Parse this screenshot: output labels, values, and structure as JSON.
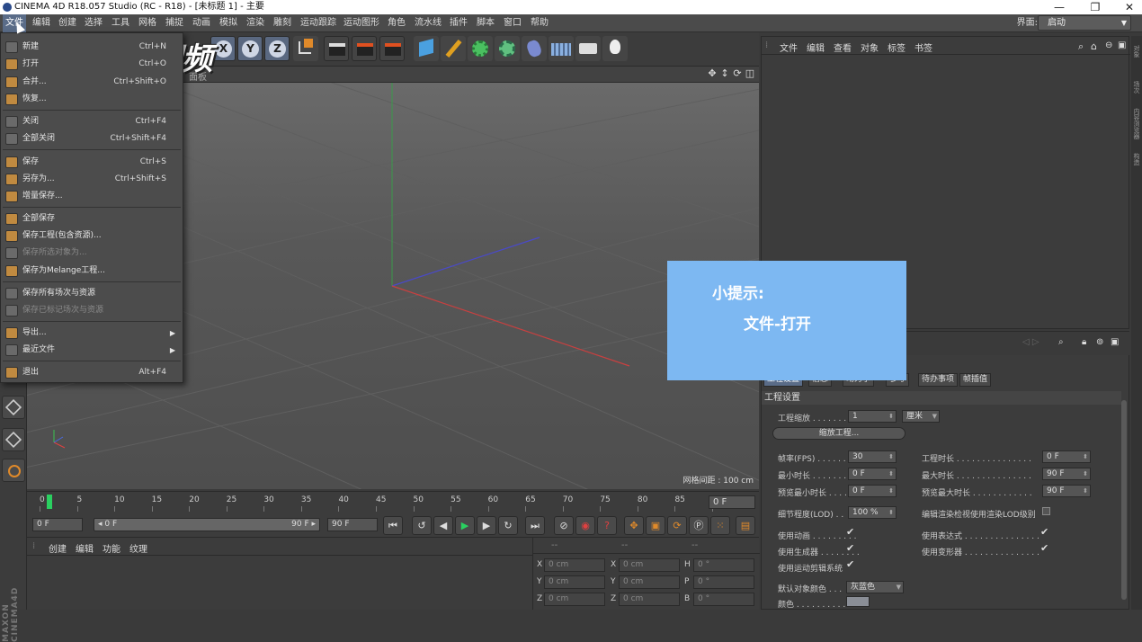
{
  "window": {
    "title": "CINEMA 4D R18.057 Studio (RC - R18) - [未标题 1] - 主要",
    "minimize": "—",
    "restore": "❐",
    "close": "✕"
  },
  "menubar": {
    "items": [
      "文件",
      "编辑",
      "创建",
      "选择",
      "工具",
      "网格",
      "捕捉",
      "动画",
      "模拟",
      "渲染",
      "雕刻",
      "运动跟踪",
      "运动图形",
      "角色",
      "流水线",
      "插件",
      "脚本",
      "窗口",
      "帮助"
    ],
    "layout_label": "界面:",
    "layout_value": "启动"
  },
  "file_menu": {
    "items": [
      {
        "label": "新建",
        "shortcut": "Ctrl+N",
        "enabled": true
      },
      {
        "label": "打开",
        "shortcut": "Ctrl+O",
        "enabled": true
      },
      {
        "label": "合并...",
        "shortcut": "Ctrl+Shift+O",
        "enabled": true
      },
      {
        "label": "恢复...",
        "shortcut": "",
        "enabled": true
      },
      {
        "label": "关闭",
        "shortcut": "Ctrl+F4",
        "enabled": true
      },
      {
        "label": "全部关闭",
        "shortcut": "Ctrl+Shift+F4",
        "enabled": true
      },
      {
        "label": "保存",
        "shortcut": "Ctrl+S",
        "enabled": true
      },
      {
        "label": "另存为...",
        "shortcut": "Ctrl+Shift+S",
        "enabled": true
      },
      {
        "label": "增量保存...",
        "shortcut": "",
        "enabled": true
      },
      {
        "label": "全部保存",
        "shortcut": "",
        "enabled": true
      },
      {
        "label": "保存工程(包含资源)...",
        "shortcut": "",
        "enabled": true
      },
      {
        "label": "保存所选对象为...",
        "shortcut": "",
        "enabled": false
      },
      {
        "label": "保存为Melange工程...",
        "shortcut": "",
        "enabled": true
      },
      {
        "label": "保存所有场次与资源",
        "shortcut": "",
        "enabled": true
      },
      {
        "label": "保存已标记场次与资源",
        "shortcut": "",
        "enabled": false
      },
      {
        "label": "导出...",
        "shortcut": "",
        "enabled": true,
        "submenu": true
      },
      {
        "label": "最近文件",
        "shortcut": "",
        "enabled": true,
        "submenu": true
      },
      {
        "label": "退出",
        "shortcut": "Alt+F4",
        "enabled": true
      }
    ]
  },
  "watermark": "秒dong视频",
  "toolbar": {
    "axis_buttons": [
      "X",
      "Y",
      "Z"
    ]
  },
  "viewport": {
    "header_label": "面板",
    "grid_spacing": "网格间距 : 100 cm"
  },
  "timeline": {
    "ticks": [
      "0",
      "5",
      "10",
      "15",
      "20",
      "25",
      "30",
      "35",
      "40",
      "45",
      "50",
      "55",
      "60",
      "65",
      "70",
      "75",
      "80",
      "85",
      "90"
    ],
    "current_frame": "0 F",
    "start_frame": "0 F",
    "range_start": "◂ 0 F",
    "range_end": "90 F ▸",
    "end_frame": "90 F"
  },
  "material_panel": {
    "menu": [
      "创建",
      "编辑",
      "功能",
      "纹理"
    ]
  },
  "coord_panel": {
    "header": [
      "--",
      "--",
      "--"
    ],
    "rows": [
      {
        "a": "X",
        "av": "0 cm",
        "b": "X",
        "bv": "0 cm",
        "c": "H",
        "cv": "0 °"
      },
      {
        "a": "Y",
        "av": "0 cm",
        "b": "Y",
        "bv": "0 cm",
        "c": "P",
        "cv": "0 °"
      },
      {
        "a": "Z",
        "av": "0 cm",
        "b": "Z",
        "bv": "0 cm",
        "c": "B",
        "cv": "0 °"
      }
    ]
  },
  "object_manager": {
    "menu": [
      "文件",
      "编辑",
      "查看",
      "对象",
      "标签",
      "书签"
    ]
  },
  "right_tabs": [
    "对象",
    "场次",
    "内容浏览器",
    "构造"
  ],
  "attribute_manager": {
    "tabs": [
      "工程设置",
      "信息",
      "动力学",
      "参考",
      "待办事项",
      "帧插值"
    ],
    "section": "工程设置",
    "scale_label": "工程缩放 . . . . . . .",
    "scale_value": "1",
    "scale_unit": "厘米",
    "scale_button": "缩放工程...",
    "fps_label": "帧率(FPS) . . . . . .",
    "fps_value": "30",
    "project_length_label": "工程时长 . . . . . . . . . . . . . . .",
    "project_length_value": "0 F",
    "min_time_label": "最小时长 . . . . . . .",
    "min_time_value": "0 F",
    "max_time_label": "最大时长 . . . . . . . . . . . . . . .",
    "max_time_value": "90 F",
    "preview_min_label": "预览最小时长 . . . .",
    "preview_min_value": "0 F",
    "preview_max_label": "预览最大时长 . . . . . . . . . . . .",
    "preview_max_value": "90 F",
    "lod_label": "细节程度(LOD) . .",
    "lod_value": "100 %",
    "lod_render_label": "编辑渲染检视使用渲染LOD级别",
    "use_anim_label": "使用动画 . . . . . . . . .",
    "use_expr_label": "使用表达式 . . . . . . . . . . . . . . .",
    "use_gen_label": "使用生成器 . . . . . . . .",
    "use_deform_label": "使用变形器 . . . . . . . . . . . . . . .",
    "use_motion_label": "使用运动剪辑系统",
    "default_color_label": "默认对象颜色 . . .",
    "default_color_value": "灰蓝色",
    "color_label": "颜色 . . . . . . . . . . .",
    "check": "✔"
  },
  "tip": {
    "title": "小提示:",
    "body": "文件-打开"
  }
}
